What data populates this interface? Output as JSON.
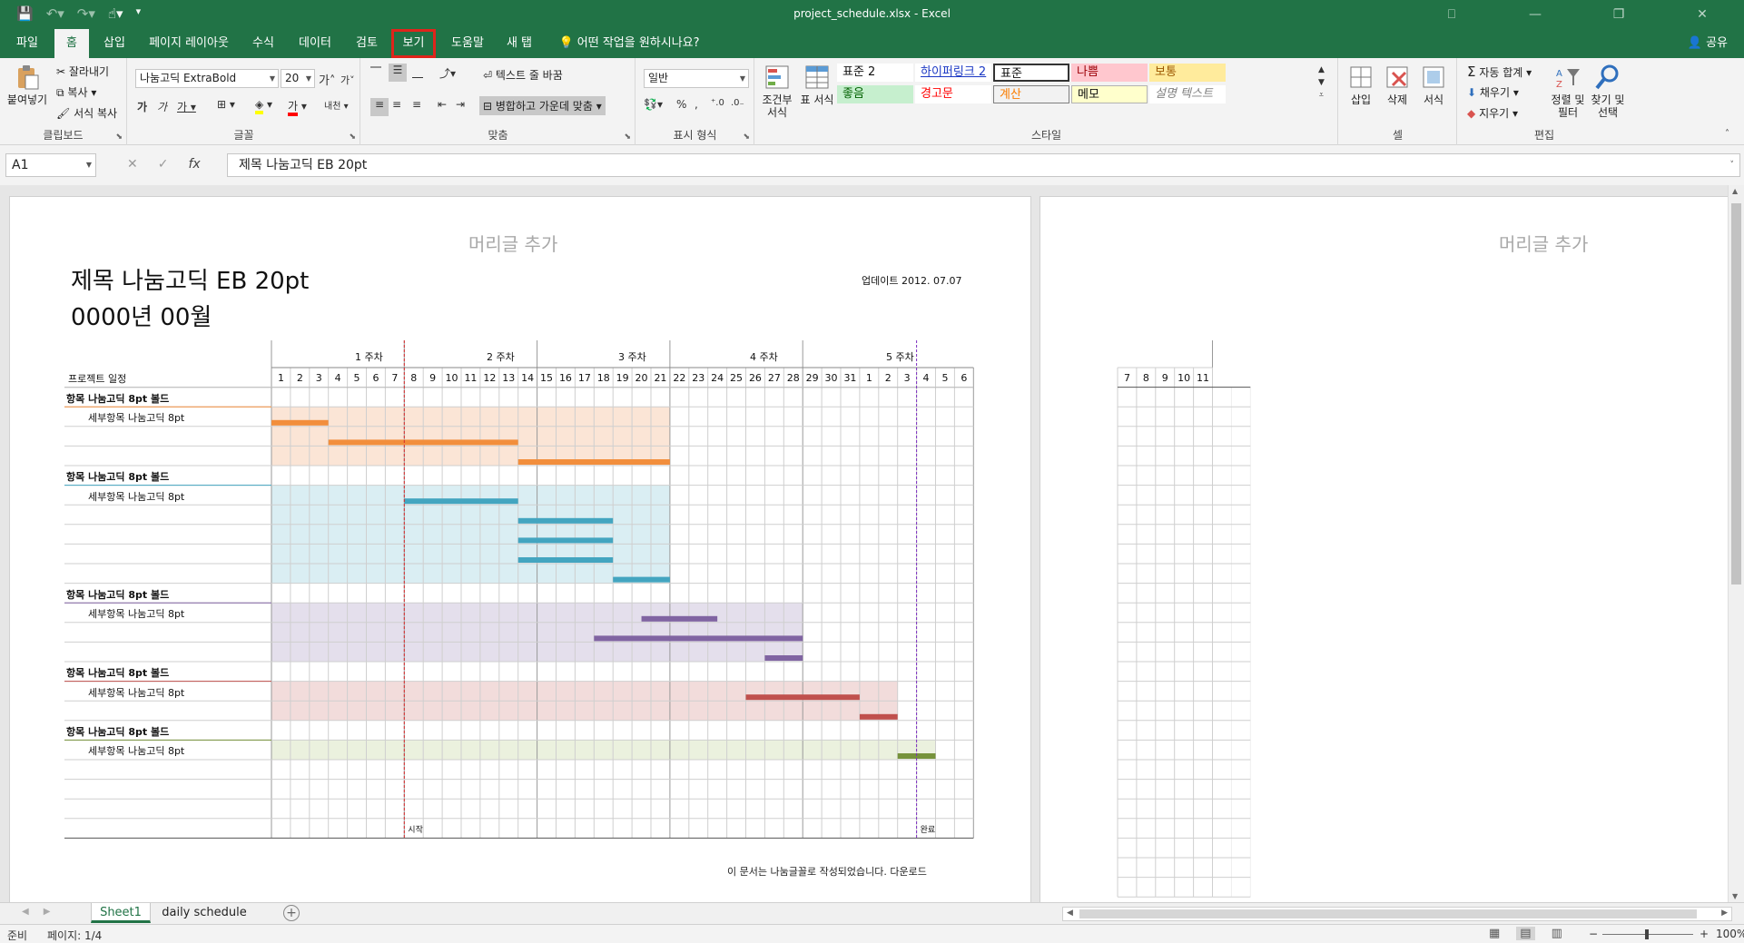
{
  "window": {
    "filename": "project_schedule.xlsx",
    "separator": "-",
    "app": "Excel",
    "buttons": [
      "⎕",
      "—",
      "❐",
      "✕"
    ]
  },
  "qat": {
    "save_icon": "save-icon",
    "undo_icon": "undo-icon",
    "redo_icon": "redo-icon",
    "touch_icon": "touch-mode-icon",
    "customize_icon": "customize-icon"
  },
  "menu": {
    "tabs": [
      "파일",
      "홈",
      "삽입",
      "페이지 레이아웃",
      "수식",
      "데이터",
      "검토",
      "보기",
      "도움말",
      "새 탭",
      "어떤 작업을 원하시나요?"
    ],
    "share": "공유"
  },
  "ribbon": {
    "clipboard": {
      "paste": "붙여넣기",
      "cut": "잘라내기",
      "copy": "복사",
      "format_painter": "서식 복사",
      "label": "클립보드"
    },
    "font": {
      "name": "나눔고딕 ExtraBold",
      "size": "20",
      "bold": "가",
      "italic": "가",
      "underline": "가",
      "grow": "가",
      "shrink": "가",
      "label": "글꼴",
      "phonetic": "내천"
    },
    "align": {
      "wrap": "텍스트 줄 바꿈",
      "merge": "병합하고 가운데 맞춤",
      "label": "맞춤"
    },
    "number": {
      "format": "일반",
      "percent": "%",
      "comma": ",",
      "label": "표시 형식"
    },
    "styles": {
      "cond_format": "조건부 서식",
      "table_format": "표 서식",
      "cells": [
        {
          "text": "표준 2",
          "bg": "#ffffff",
          "color": "#111111"
        },
        {
          "text": "하이퍼링크 2",
          "bg": "#ffffff",
          "color": "#1b38c4"
        },
        {
          "text": "표준",
          "bg": "#ffffff",
          "color": "#111111"
        },
        {
          "text": "나쁨",
          "bg": "#ffc7ce",
          "color": "#9c0006"
        },
        {
          "text": "보통",
          "bg": "#ffeb9c",
          "color": "#9c5700"
        },
        {
          "text": "좋음",
          "bg": "#c6efce",
          "color": "#006100"
        },
        {
          "text": "경고문",
          "bg": "#ffffff",
          "color": "#ff0000"
        },
        {
          "text": "계산",
          "bg": "#f2f2f2",
          "color": "#fa7d00"
        },
        {
          "text": "메모",
          "bg": "#ffffcc",
          "color": "#111111"
        },
        {
          "text": "설명 텍스트",
          "bg": "#ffffff",
          "color": "#7f7f7f"
        }
      ],
      "label": "스타일"
    },
    "cells": {
      "insert": "삽입",
      "delete": "삭제",
      "format": "서식",
      "label": "셀"
    },
    "editing": {
      "autosum": "자동 합계",
      "fill": "채우기",
      "clear": "지우기",
      "sort": "정렬 및 필터",
      "find": "찾기 및 선택",
      "label": "편집"
    }
  },
  "formula_bar": {
    "cell": "A1",
    "content": "제목 나눔고딕 EB 20pt",
    "fx": "fx",
    "cancel": "✕",
    "enter": "✓"
  },
  "page1": {
    "header_placeholder": "머리글 추가",
    "title": "제목 나눔고딕 EB 20pt",
    "subtitle": "0000년 00월",
    "updated": "업데이트 2012. 07.07",
    "project_label": "프로젝트 일정",
    "weeks": [
      "1 주차",
      "2 주차",
      "3 주차",
      "4 주차",
      "5 주차"
    ],
    "days": [
      "1",
      "2",
      "3",
      "4",
      "5",
      "6",
      "7",
      "8",
      "9",
      "10",
      "11",
      "12",
      "13",
      "14",
      "15",
      "16",
      "17",
      "18",
      "19",
      "20",
      "21",
      "22",
      "23",
      "24",
      "25",
      "26",
      "27",
      "28",
      "29",
      "30",
      "31",
      "1",
      "2",
      "3",
      "4",
      "5",
      "6"
    ],
    "start_mark": "시작",
    "end_mark": "완료",
    "footnote": "이 문서는 나눔글꼴로 작성되었습니다. 다운로드",
    "groups": [
      {
        "title": "항목 나눔고딕 8pt 볼드",
        "subtitle": "세부항목 나눔고딕 8pt",
        "color": "#f28e3c",
        "fill": "#fbe5d6",
        "bars": [
          {
            "start": 1,
            "end": 3
          },
          {
            "start": 4,
            "end": 13
          },
          {
            "start": 14,
            "end": 21
          }
        ],
        "shade_rows": 3,
        "shade_end": 21
      },
      {
        "title": "항목 나눔고딕 8pt 볼드",
        "subtitle": "세부항목 나눔고딕 8pt",
        "color": "#43a5c0",
        "fill": "#daeef3",
        "bars": [
          {
            "start": 8,
            "end": 13
          },
          {
            "start": 14,
            "end": 18
          },
          {
            "start": 14,
            "end": 18
          },
          {
            "start": 14,
            "end": 18
          },
          {
            "start": 19,
            "end": 21
          }
        ],
        "shade_rows": 5,
        "shade_end": 21
      },
      {
        "title": "항목 나눔고딕 8pt 볼드",
        "subtitle": "세부항목 나눔고딕 8pt",
        "color": "#8064a2",
        "fill": "#e4dfec",
        "bars": [
          {
            "start": 20.5,
            "end": 23.5
          },
          {
            "start": 18,
            "end": 28
          },
          {
            "start": 27,
            "end": 28
          }
        ],
        "shade_rows": 3,
        "shade_end": 28
      },
      {
        "title": "항목 나눔고딕 8pt 볼드",
        "subtitle": "세부항목 나눔고딕 8pt",
        "color": "#c0504d",
        "fill": "#f2dcdb",
        "bars": [
          {
            "start": 26,
            "end": 31
          },
          {
            "start": 32,
            "end": 33
          }
        ],
        "shade_rows": 2,
        "shade_end": 33
      },
      {
        "title": "항목 나눔고딕 8pt 볼드",
        "subtitle": "세부항목 나눔고딕 8pt",
        "color": "#77933c",
        "fill": "#ebf1de",
        "bars": [
          {
            "start": 34,
            "end": 35
          }
        ],
        "shade_rows": 1,
        "shade_end": 35
      }
    ]
  },
  "page2": {
    "header_placeholder": "머리글 추가",
    "days": [
      "7",
      "8",
      "9",
      "10",
      "11"
    ]
  },
  "sheets": {
    "tabs": [
      "Sheet1",
      "daily schedule"
    ],
    "add": "+"
  },
  "status": {
    "ready": "준비",
    "page": "페이지: 1/4",
    "zoom": "100%",
    "minus": "−",
    "plus": "+"
  }
}
